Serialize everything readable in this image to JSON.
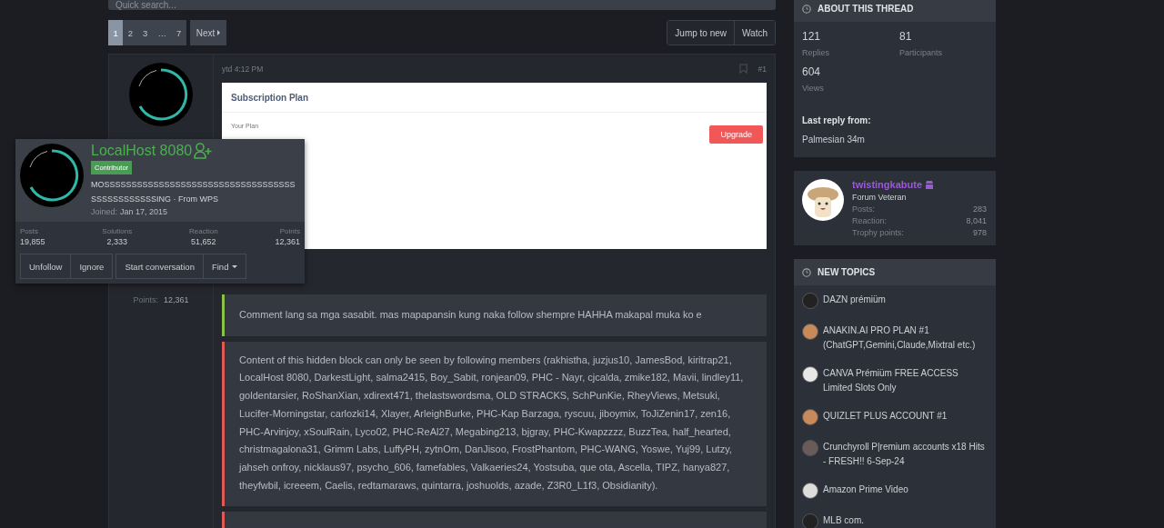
{
  "search": {
    "placeholder": "Quick search..."
  },
  "pagination": {
    "pages": [
      {
        "label": "1",
        "selected": true
      },
      {
        "label": "2",
        "selected": false
      },
      {
        "label": "3",
        "selected": false
      },
      {
        "label": "…",
        "selected": false
      },
      {
        "label": "7",
        "selected": false
      }
    ],
    "next": "Next"
  },
  "thread_actions": [
    "Jump to new",
    "Watch"
  ],
  "post": {
    "time": "ytd 4:12 PM",
    "number": "#1",
    "attachment": {
      "title": "Subscription Plan",
      "label": "Your Plan",
      "button": "Upgrade"
    },
    "author_stats": [
      {
        "label": "Points:",
        "value": "12,361"
      }
    ],
    "blocks": [
      {
        "kind": "comment",
        "color": "#8bc34a",
        "text": "Comment lang sa mga sasabit. mas mapapansin kung naka follow shempre HAHHA makapal muka ko e"
      },
      {
        "kind": "hidden",
        "color": "#e05a55",
        "text": "Content of this hidden block can only be seen by following members (rakhistha, juzjus10, JamesBod, kiritrap21, LocalHost 8080, DarkestLight, salma2415, Boy_Sabit, ronjean09, PHC - Nayr, cjcalda, zmike182, Mavii, lindley11, goldentarsier, RoShanXian, xdirext471, thelastswordsma, OLD STRACKS, SchPunKie, RheyViews, Metsuki, Lucifer-Morningstar, carlozki14, Xlayer, ArleighBurke, PHC-Kap Barzaga, ryscuu, jiboymix, ToJiZenin17, zen16, PHC-Arvinjoy, xSoulRain, Lyco02, PHC-ReAl27, Megabing213, bjgray, PHC-Kwapzzzz, BuzzTea, half_hearted, christmagalona31, Grimm Labs, LuffyPH, zytnOm, DanJisoo, FrostPhantom, PHC-WANG, Yoswe, Yuj99, Lutzy, jahseh onfroy, nicklaus97, psycho_606, famefables, Valkaeries24, Yostsuba, que ota, Ascella, TIPZ, hanya827, theyfwbil, icreeem, Caelis, redtamaraws, quintarra, joshuolds, azade, Z3R0_L1f3, Obsidianity)."
      },
      {
        "kind": "hidden",
        "color": "#e05a55"
      }
    ]
  },
  "member_card": {
    "name": "LocalHost 8080",
    "badge": "Contributor",
    "about": "MOSSSSSSSSSSSSSSSSSSSSSSSSSSSSSSSSSSSSSSSSSSSSSSSING · From WPS",
    "joined_label": "Joined:",
    "joined": "Jan 17, 2015",
    "stats": [
      {
        "label": "Posts",
        "value": "19,855"
      },
      {
        "label": "Solutions",
        "value": "2,333"
      },
      {
        "label": "Reaction",
        "value": "51,652"
      },
      {
        "label": "Points",
        "value": "12,361"
      }
    ],
    "actions": [
      {
        "label": "Unfollow",
        "kind": "plain"
      },
      {
        "label": "Ignore",
        "kind": "plain"
      },
      {
        "label": "Start conversation",
        "kind": "plain"
      },
      {
        "label": "Find",
        "kind": "menu"
      }
    ]
  },
  "about_thread": {
    "title": "ABOUT THIS THREAD",
    "stats": [
      {
        "value": "121",
        "label": "Replies"
      },
      {
        "value": "81",
        "label": "Participants"
      },
      {
        "value": "604",
        "label": "Views"
      }
    ],
    "last_reply_label": "Last reply from:",
    "last_reply": "Palmesian 34m"
  },
  "featured_member": {
    "name": "twistingkabute",
    "title": "Forum Veteran",
    "stats": [
      {
        "label": "Posts:",
        "value": "283"
      },
      {
        "label": "Reaction:",
        "value": "8,041"
      },
      {
        "label": "Trophy points:",
        "value": "978"
      }
    ]
  },
  "new_topics": {
    "title": "NEW TOPICS",
    "items": [
      "DAZN prémiüm",
      "ANAKIN.AI PRO PLAN #1 (ChatGPT,Gemini,Claude,Mixtral etc.)",
      "CANVA Prémiüm FREE ACCESS Limited Slots Only",
      "QUIZLET PLUS ACCOUNT #1",
      "Crunchyroll P|remium accounts x18 Hits - FRESH!! 6-Sep-24",
      "Amazon Prime Video",
      "MLB com."
    ]
  }
}
